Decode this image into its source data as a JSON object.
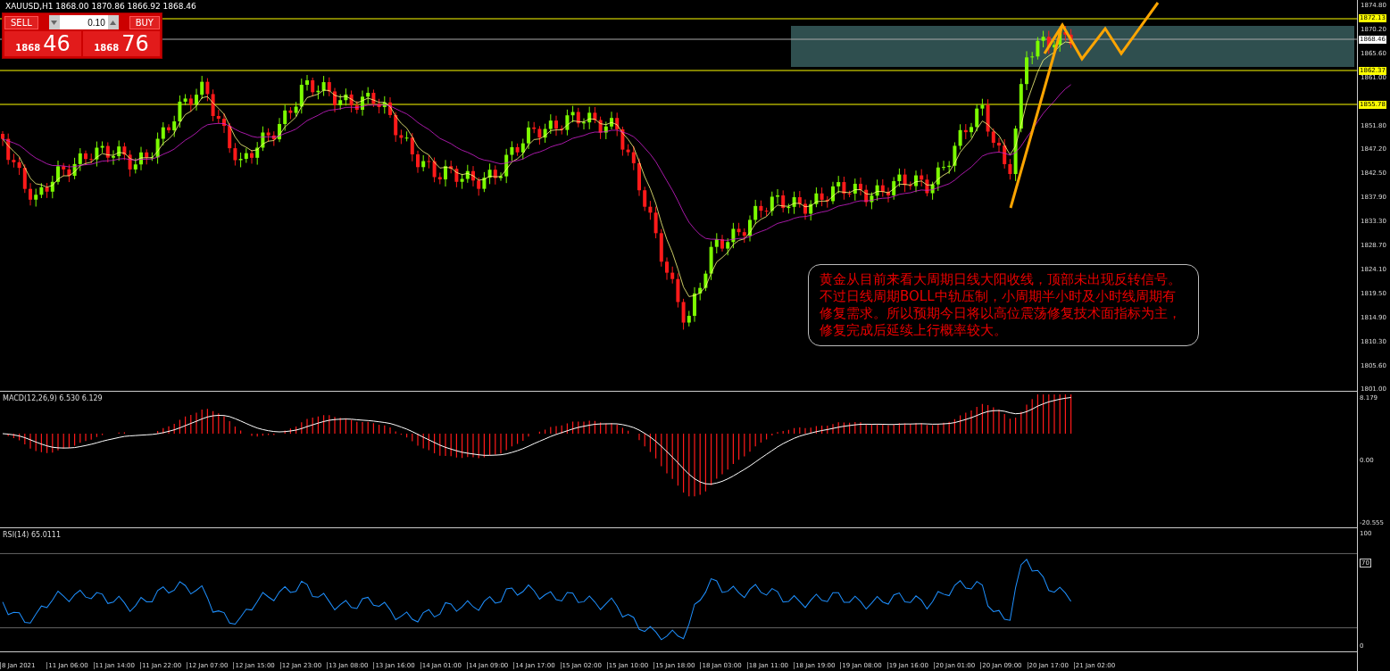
{
  "chart_header": "XAUUSD,H1  1868.00 1870.86 1866.92 1868.46",
  "trade_panel": {
    "sell": {
      "label": "SELL",
      "price_big": "1868",
      "price_small": "46"
    },
    "lot": "0.10",
    "buy": {
      "label": "BUY",
      "price_big": "1868",
      "price_small": "76"
    }
  },
  "price_axis": [
    "1874.80",
    "1870.20",
    "1865.60",
    "1861.00",
    "1851.80",
    "1847.20",
    "1842.50",
    "1837.90",
    "1833.30",
    "1828.70",
    "1824.10",
    "1819.50",
    "1814.90",
    "1810.30",
    "1805.60",
    "1801.00"
  ],
  "level_tags": [
    {
      "label": "1872.13",
      "color": "#ffff00"
    },
    {
      "label": "1868.46",
      "color": "#ffffff"
    },
    {
      "label": "1862.37",
      "color": "#ffff00"
    },
    {
      "label": "1855.78",
      "color": "#ffff00"
    }
  ],
  "annotation": "黄金从目前来看大周期日线大阳收线，顶部未出现反转信号。不过日线周期BOLL中轨压制，小周期半小时及小时线周期有修复需求。所以预期今日将以高位震荡修复技术面指标为主，修复完成后延续上行概率较大。",
  "macd": {
    "label": "MACD(12,26,9) 6.530 6.129",
    "axis": [
      "8.179",
      "0.00",
      "-20.555"
    ]
  },
  "rsi": {
    "label": "RSI(14) 65.0111",
    "axis": [
      "100",
      "70",
      "0"
    ]
  },
  "time_axis": [
    "8 Jan 2021",
    "11 Jan 06:00",
    "11 Jan 14:00",
    "11 Jan 22:00",
    "12 Jan 07:00",
    "12 Jan 15:00",
    "12 Jan 23:00",
    "13 Jan 08:00",
    "13 Jan 16:00",
    "14 Jan 01:00",
    "14 Jan 09:00",
    "14 Jan 17:00",
    "15 Jan 02:00",
    "15 Jan 10:00",
    "15 Jan 18:00",
    "18 Jan 03:00",
    "18 Jan 11:00",
    "18 Jan 19:00",
    "19 Jan 08:00",
    "19 Jan 16:00",
    "20 Jan 01:00",
    "20 Jan 09:00",
    "20 Jan 17:00",
    "21 Jan 02:00"
  ]
}
